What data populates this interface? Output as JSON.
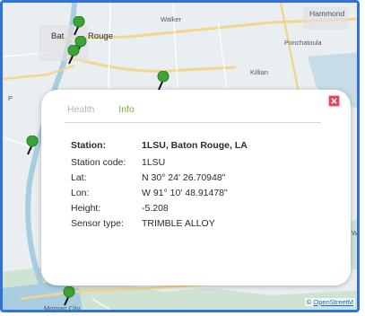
{
  "map": {
    "labels": {
      "walker": "Walker",
      "hammond": "Hammond",
      "baton": "Bat",
      "rouge": "Rouge",
      "ponchatoula": "Ponchatoula",
      "killian": "Killian",
      "p_left": "P",
      "wa_right": "Wa",
      "morgan_city": "Morgan City"
    },
    "attribution": {
      "prefix": "© ",
      "link": "OpenStreetM"
    },
    "colors": {
      "land": "#e9eef0",
      "water": "#a9cde0",
      "marsh": "#cfe3d3",
      "road_major": "#f3d68e",
      "road_minor": "#ffffff",
      "pin": "#3aa535",
      "frame": "#2f73d9"
    }
  },
  "popup": {
    "tabs": [
      "Health",
      "Info"
    ],
    "active_tab": "Info",
    "close_icon": "close-icon",
    "fields": {
      "station": {
        "label": "Station:",
        "value": "1LSU, Baton Rouge, LA"
      },
      "station_code": {
        "label": "Station code:",
        "value": "1LSU"
      },
      "lat": {
        "label": "Lat:",
        "value": "N 30° 24' 26.70948\""
      },
      "lon": {
        "label": "Lon:",
        "value": "W 91° 10' 48.91478\""
      },
      "height": {
        "label": "Height:",
        "value": "-5.208"
      },
      "sensor_type": {
        "label": "Sensor type:",
        "value": "TRIMBLE ALLOY"
      }
    }
  }
}
